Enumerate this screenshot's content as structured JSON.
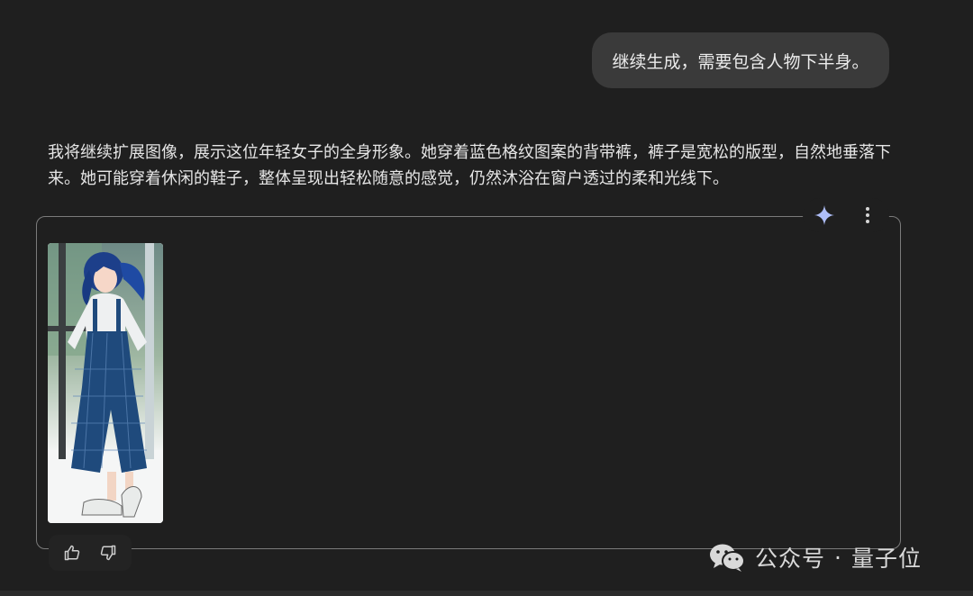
{
  "user_message": {
    "text": "继续生成，需要包含人物下半身。"
  },
  "assistant": {
    "paragraph": "我将继续扩展图像，展示这位年轻女子的全身形象。她穿着蓝色格纹图案的背带裤，裤子是宽松的版型，自然地垂落下来。她可能穿着休闲的鞋子，整体呈现出轻松随意的感觉，仍然沐浴在窗户透过的柔和光线下。"
  },
  "image_toolbar": {
    "icons": [
      "sparkle-icon",
      "more-vert-icon"
    ],
    "sparkle_color": "#aebdf7"
  },
  "feedback": {
    "icons": [
      "thumbs-up-icon",
      "thumbs-down-icon"
    ]
  },
  "watermark": {
    "dot": "·",
    "left_text": "公众号",
    "right_text": "量子位",
    "icon": "wechat-icon"
  },
  "colors": {
    "background": "#1f1f1f",
    "bubble": "#3a3a3a",
    "overalls": "#1f4a7c"
  }
}
